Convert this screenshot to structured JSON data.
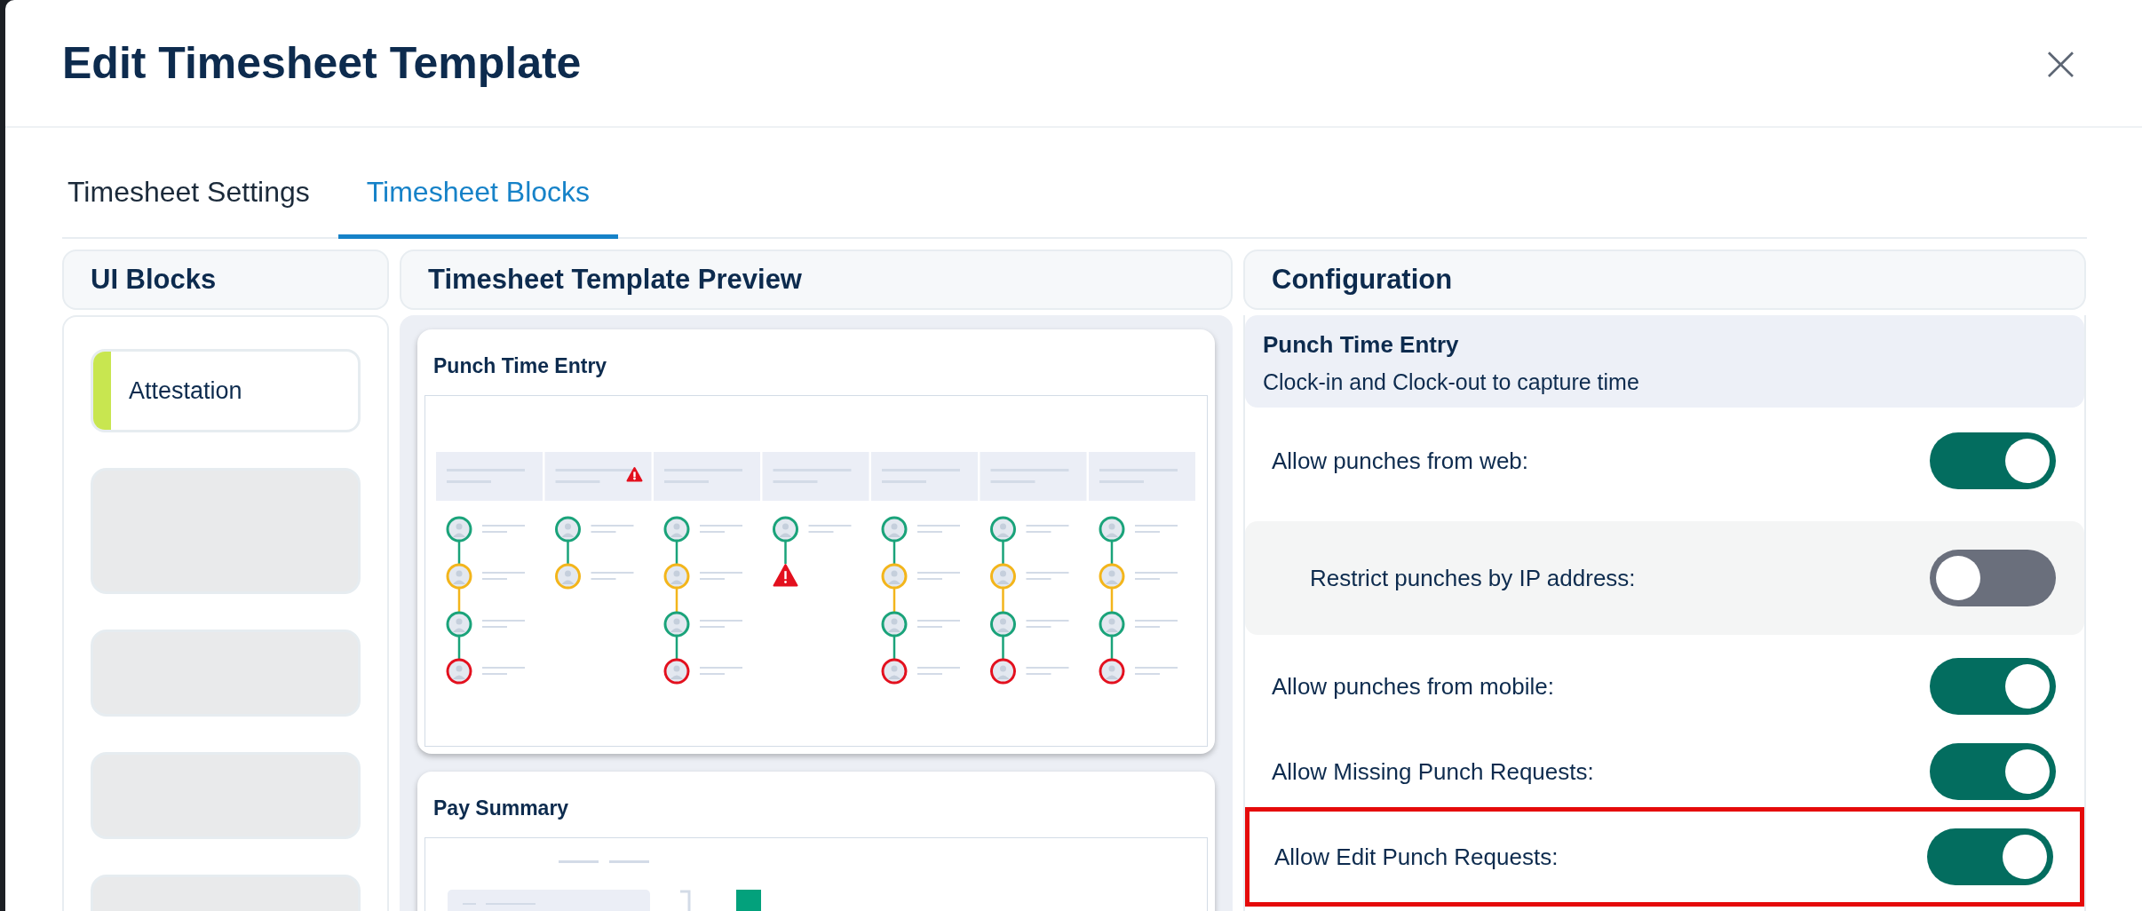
{
  "dialog": {
    "title": "Edit Timesheet Template",
    "close": "×"
  },
  "tabs": [
    {
      "label": "Timesheet Settings",
      "selected": false
    },
    {
      "label": "Timesheet Blocks",
      "selected": true
    }
  ],
  "ui_blocks": {
    "title": "UI Blocks",
    "items": [
      {
        "kind": "block",
        "label": "Attestation",
        "color": "#c8e650"
      },
      {
        "kind": "placeholder-tall"
      },
      {
        "kind": "placeholder"
      },
      {
        "kind": "placeholder"
      },
      {
        "kind": "placeholder"
      }
    ]
  },
  "preview": {
    "title": "Timesheet Template Preview",
    "cards": [
      {
        "kind": "punch",
        "title": "Punch Time Entry"
      },
      {
        "kind": "pay",
        "title": "Pay Summary"
      }
    ]
  },
  "configuration": {
    "title": "Configuration",
    "section_title": "Punch Time Entry",
    "section_subtitle": "Clock-in and Clock-out to capture time",
    "rows": [
      {
        "kind": "main",
        "label": "Allow punches from web:",
        "on": true,
        "highlighted": false
      },
      {
        "kind": "sub",
        "label": "Restrict punches by IP address:",
        "on": false,
        "highlighted": false
      },
      {
        "kind": "main",
        "label": "Allow punches from mobile:",
        "on": true,
        "highlighted": false
      },
      {
        "kind": "main",
        "label": "Allow Missing Punch Requests:",
        "on": true,
        "highlighted": false
      },
      {
        "kind": "main",
        "label": "Allow Edit Punch Requests:",
        "on": true,
        "highlighted": true
      }
    ]
  }
}
